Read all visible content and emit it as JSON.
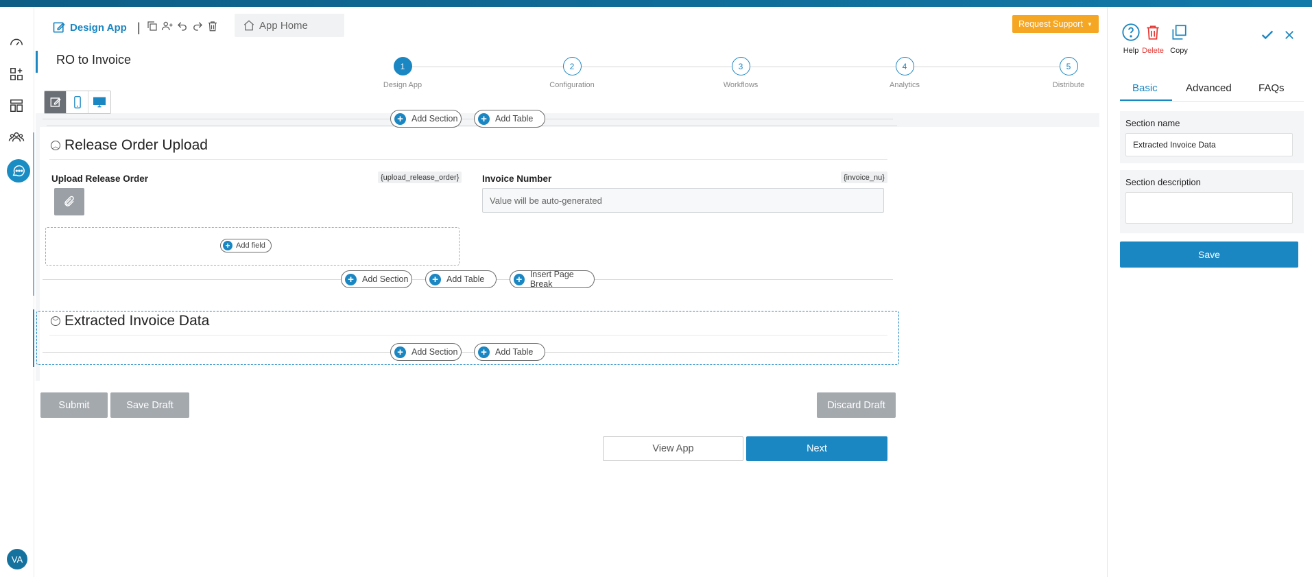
{
  "header": {
    "design_tab": "Design App",
    "home_tab": "App Home",
    "request_support": "Request Support",
    "app_title": "RO to Invoice",
    "separator": "|"
  },
  "steps": [
    {
      "num": "1",
      "label": "Design App",
      "active": true
    },
    {
      "num": "2",
      "label": "Configuration"
    },
    {
      "num": "3",
      "label": "Workflows"
    },
    {
      "num": "4",
      "label": "Analytics"
    },
    {
      "num": "5",
      "label": "Distribute"
    }
  ],
  "canvas": {
    "add_section": "Add Section",
    "add_table": "Add Table",
    "add_field": "Add field",
    "insert_page_break": "Insert Page Break",
    "section1": {
      "title": "Release Order Upload",
      "field1_label": "Upload Release Order",
      "field1_tag": "{upload_release_order}",
      "field2_label": "Invoice Number",
      "field2_tag": "{invoice_nu}",
      "field2_value": "Value will be auto-generated"
    },
    "section2": {
      "title": "Extracted Invoice Data"
    }
  },
  "footer": {
    "submit": "Submit",
    "save_draft": "Save Draft",
    "discard_draft": "Discard Draft",
    "view_app": "View App",
    "next": "Next"
  },
  "rail": {
    "avatar": "VA"
  },
  "right_panel": {
    "help": "Help",
    "delete": "Delete",
    "copy": "Copy",
    "tabs": [
      "Basic",
      "Advanced",
      "FAQs"
    ],
    "section_name_label": "Section name",
    "section_name_value": "Extracted Invoice Data",
    "section_desc_label": "Section description",
    "section_desc_value": "",
    "save": "Save"
  },
  "colors": {
    "accent": "#1a86c2",
    "warning": "#f5a623",
    "danger": "#e53935",
    "muted_button": "#a4a9ae"
  }
}
